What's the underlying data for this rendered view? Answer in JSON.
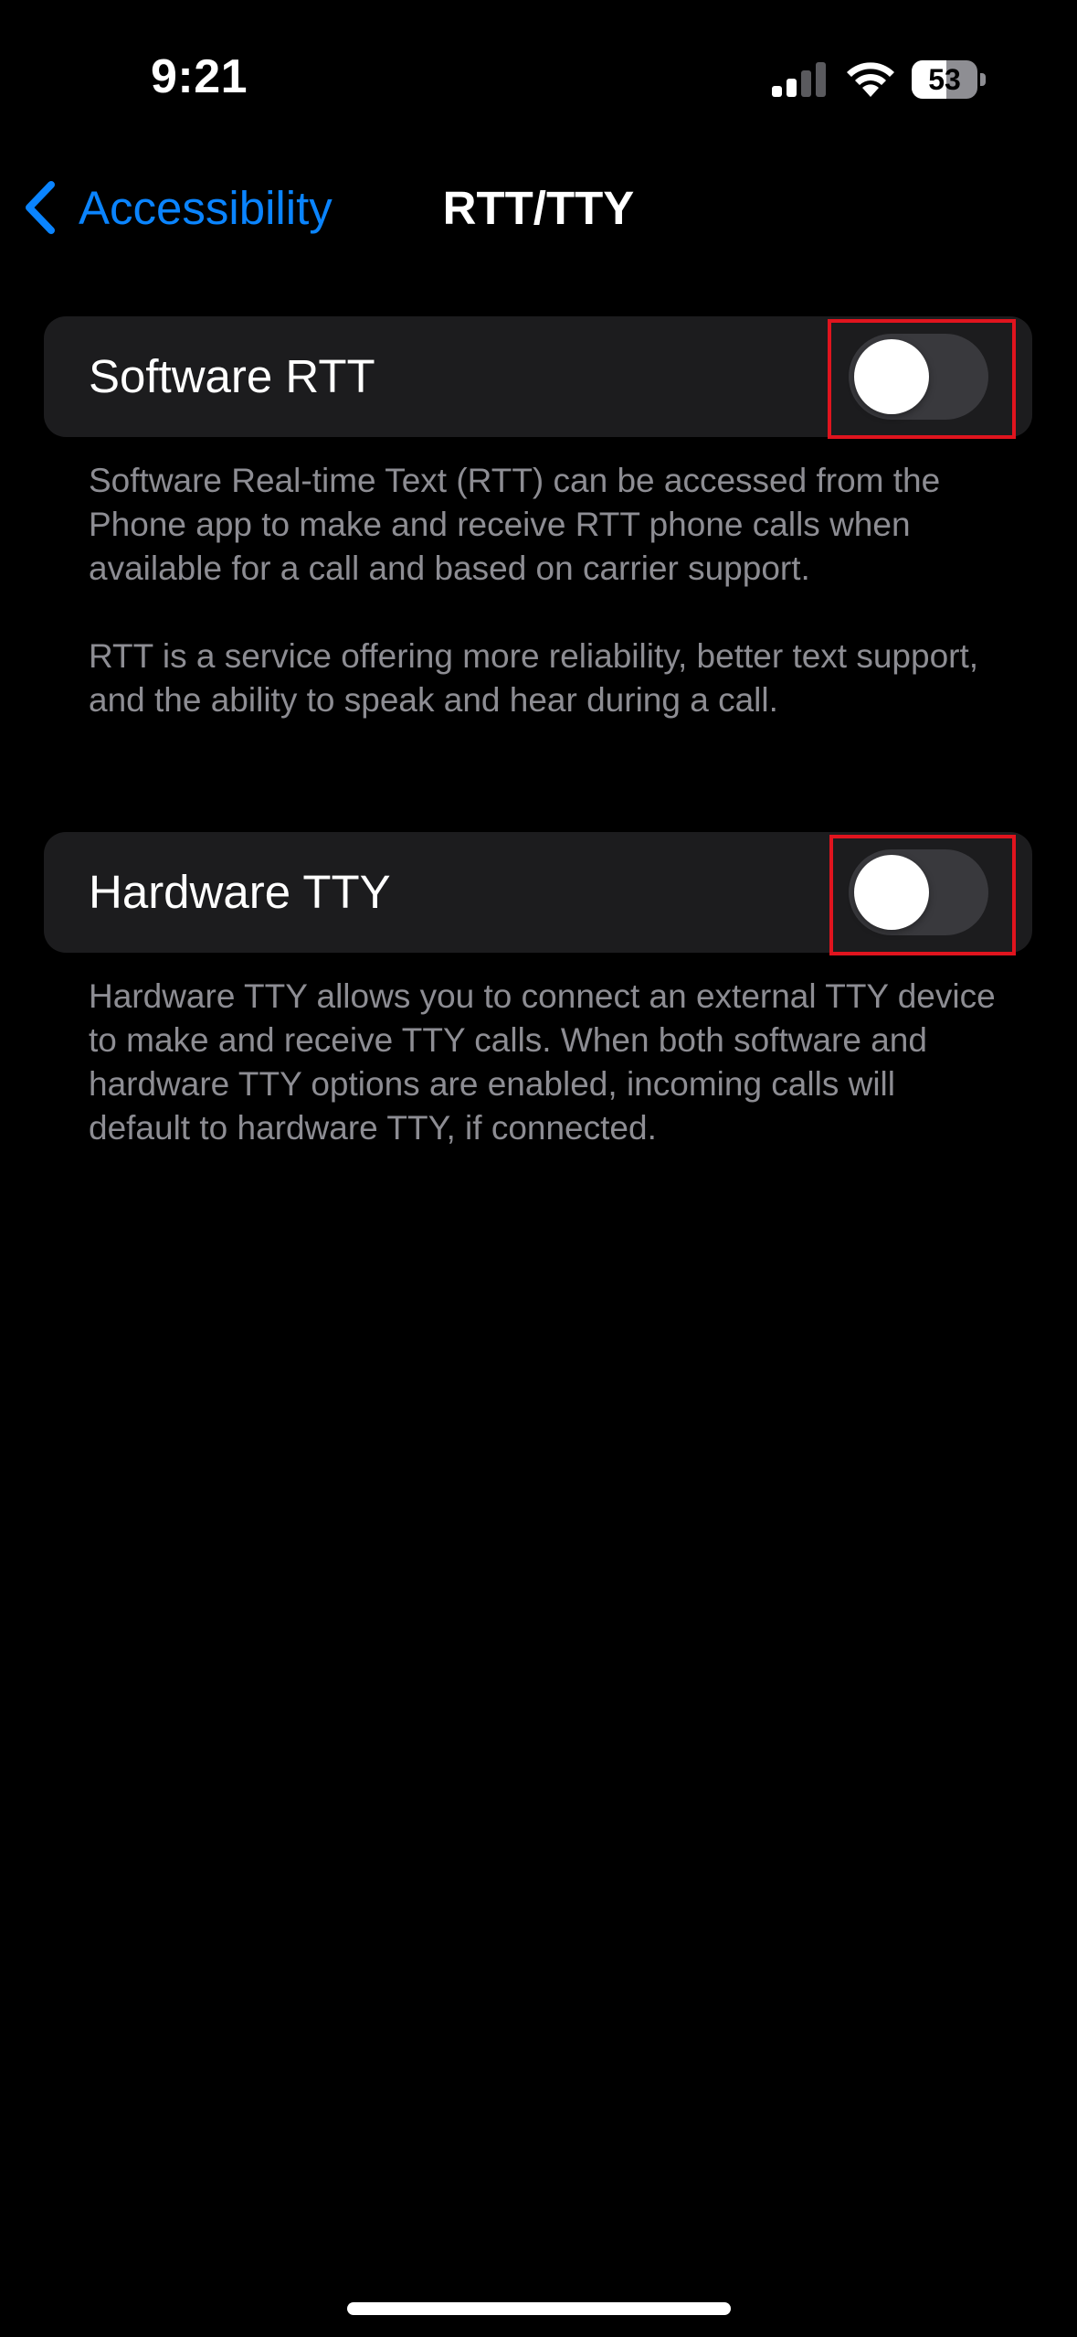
{
  "status_bar": {
    "time": "9:21",
    "battery_percent": "53",
    "battery_level": 0.53,
    "icons": [
      "signal-icon",
      "wifi-icon",
      "battery-icon"
    ]
  },
  "nav": {
    "back_label": "Accessibility",
    "back_icon": "chevron-left-icon",
    "title": "RTT/TTY"
  },
  "settings": {
    "software_rtt": {
      "label": "Software RTT",
      "enabled": false,
      "footer_1": "Software Real-time Text (RTT) can be accessed from the Phone app to make and receive RTT phone calls when available for a call and based on carrier support.",
      "footer_2": "RTT is a service offering more reliability, better text support, and the ability to speak and hear during a call."
    },
    "hardware_tty": {
      "label": "Hardware TTY",
      "enabled": false,
      "footer": "Hardware TTY allows you to connect an external TTY device to make and receive TTY calls. When both software and hardware TTY options are enabled, incoming calls will default to hardware TTY, if connected."
    }
  },
  "colors": {
    "background": "#000000",
    "cell_background": "#1c1c1e",
    "accent": "#0a84ff",
    "toggle_off": "#39393d",
    "secondary_text": "#8d8d93",
    "highlight": "#e0141e"
  }
}
